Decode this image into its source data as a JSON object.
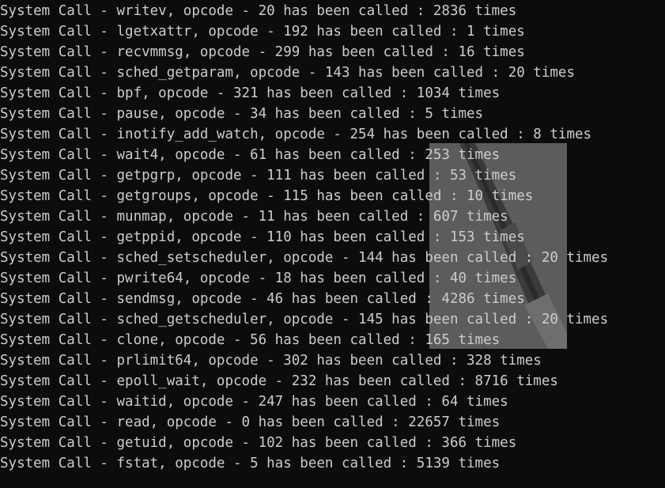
{
  "terminal": {
    "lines": [
      "System Call - writev, opcode - 20 has been called : 2836 times",
      "System Call - lgetxattr, opcode - 192 has been called : 1 times",
      "System Call - recvmmsg, opcode - 299 has been called : 16 times",
      "System Call - sched_getparam, opcode - 143 has been called : 20 times",
      "System Call - bpf, opcode - 321 has been called : 1034 times",
      "System Call - pause, opcode - 34 has been called : 5 times",
      "System Call - inotify_add_watch, opcode - 254 has been called : 8 times",
      "System Call - wait4, opcode - 61 has been called : 253 times",
      "System Call - getpgrp, opcode - 111 has been called : 53 times",
      "System Call - getgroups, opcode - 115 has been called : 10 times",
      "System Call - munmap, opcode - 11 has been called : 607 times",
      "System Call - getppid, opcode - 110 has been called : 153 times",
      "System Call - sched_setscheduler, opcode - 144 has been called : 20 times",
      "System Call - pwrite64, opcode - 18 has been called : 40 times",
      "System Call - sendmsg, opcode - 46 has been called : 4286 times",
      "System Call - sched_getscheduler, opcode - 145 has been called : 20 times",
      "System Call - clone, opcode - 56 has been called : 165 times",
      "System Call - prlimit64, opcode - 302 has been called : 328 times",
      "System Call - epoll_wait, opcode - 232 has been called : 8716 times",
      "System Call - waitid, opcode - 247 has been called : 64 times",
      "System Call - read, opcode - 0 has been called : 22657 times",
      "System Call - getuid, opcode - 102 has been called : 366 times",
      "System Call - fstat, opcode - 5 has been called : 5139 times"
    ]
  },
  "colors": {
    "background": "#0c0c0c",
    "text": "#cccccc",
    "overlay": "#5d5d5d"
  }
}
